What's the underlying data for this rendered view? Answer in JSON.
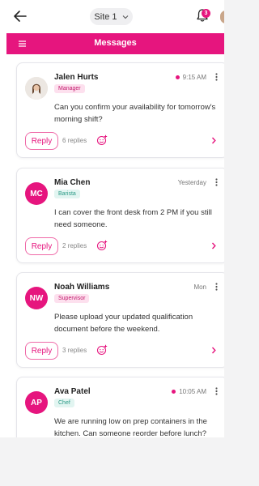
{
  "topbar": {
    "site_label": "Site 1",
    "notification_count": "3"
  },
  "header": {
    "title": "Messages"
  },
  "colors": {
    "accent": "#e6157e",
    "manager_tag": "#fde0ee",
    "barista_tag": "#e2f5f1",
    "supervisor_tag": "#fde0ee",
    "chef_tag": "#e2f5f1"
  },
  "messages": [
    {
      "name": "Jalen Hurts",
      "role": "Manager",
      "time": "9:15 AM",
      "unread": true,
      "avatar": "photo",
      "text": "Can you confirm your availability for tomorrow's morning shift?",
      "reply_label": "Reply",
      "replies": "6 replies"
    },
    {
      "name": "Mia Chen",
      "role": "Barista",
      "time": "Yesterday",
      "unread": false,
      "initials": "MC",
      "text": "I can cover the front desk from 2 PM if you still need someone.",
      "reply_label": "Reply",
      "replies": "2 replies"
    },
    {
      "name": "Noah Williams",
      "role": "Supervisor",
      "time": "Mon",
      "unread": false,
      "initials": "NW",
      "text": "Please upload your updated qualification document before the weekend.",
      "reply_label": "Reply",
      "replies": "3 replies"
    },
    {
      "name": "Ava Patel",
      "role": "Chef",
      "time": "10:05 AM",
      "unread": true,
      "initials": "AP",
      "text": "We are running low on prep containers in the kitchen. Can someone reorder before lunch?"
    }
  ]
}
